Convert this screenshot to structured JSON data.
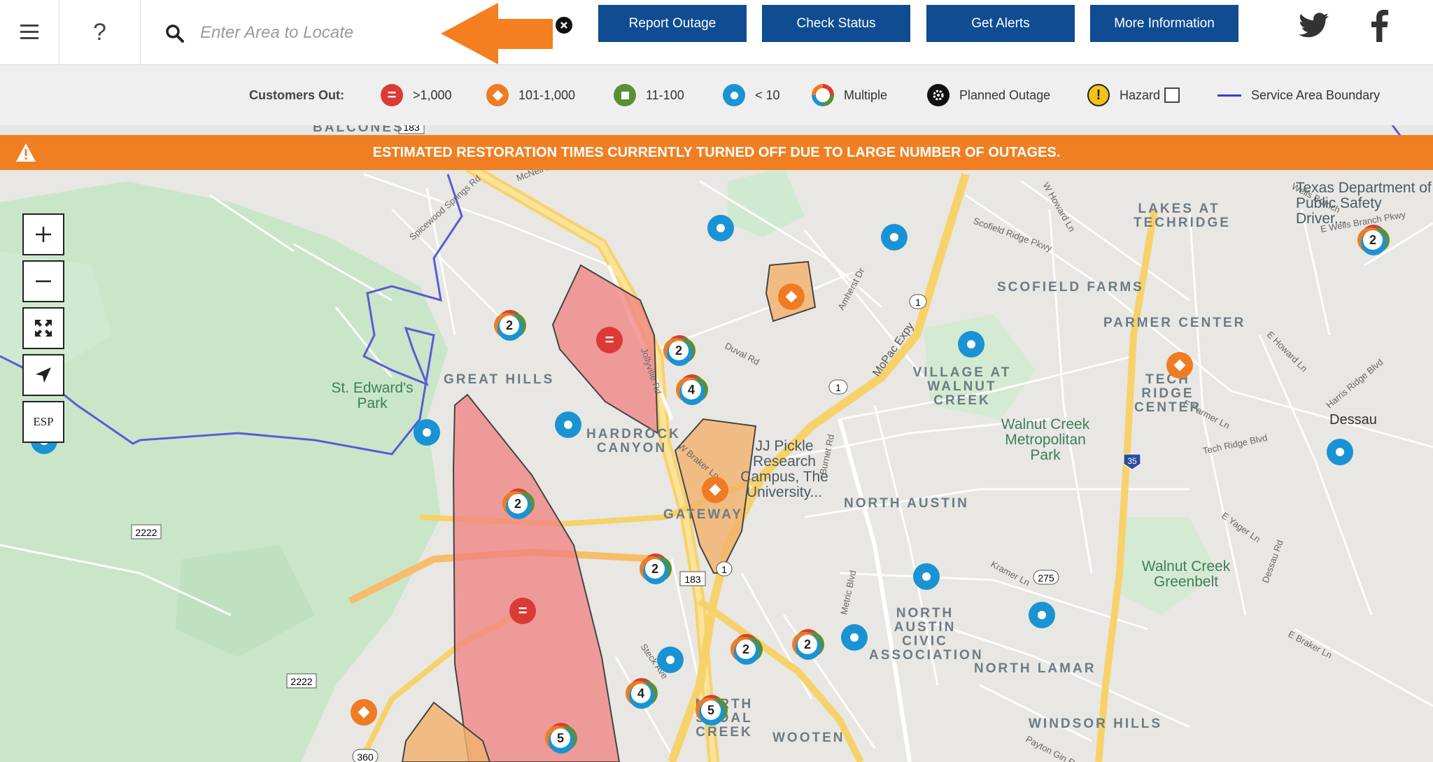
{
  "header": {
    "help_label": "?",
    "search_placeholder": "Enter Area to Locate",
    "buttons": [
      "Report Outage",
      "Check Status",
      "Get Alerts",
      "More Information"
    ]
  },
  "legend": {
    "title": "Customers Out:",
    "items": [
      ">1,000",
      "101-1,000",
      "11-100",
      "< 10",
      "Multiple",
      "Planned Outage",
      "Hazard",
      "Service Area Boundary"
    ]
  },
  "banner": {
    "text": "ESTIMATED RESTORATION TIMES CURRENTLY TURNED OFF DUE TO LARGE NUMBER OF OUTAGES."
  },
  "controls": {
    "language_label": "ESP"
  },
  "map_labels": {
    "areas": [
      "GREAT HILLS",
      "HARDROCK CANYON",
      "GATEWAY",
      "NORTH AUSTIN",
      "LAKES AT TECHRIDGE",
      "SCOFIELD FARMS",
      "PARMER CENTER",
      "VILLAGE AT WALNUT CREEK",
      "TECH RIDGE CENTER",
      "NORTH AUSTIN CIVIC ASSOCIATION",
      "NORTH LAMAR",
      "NORTH SHOAL CREEK",
      "WOOTEN",
      "WINDSOR HILLS",
      "BALCONES"
    ],
    "parks": [
      "St. Edward's Park",
      "Walnut Creek Metropolitan Park",
      "Walnut Creek Greenbelt"
    ],
    "places": [
      "JJ Pickle Research Campus, The University...",
      "Texas Department of Public Safety Driver...",
      "Dessau"
    ],
    "roads": [
      "MoPac Expy",
      "Duval Rd",
      "Spicewood Springs Rd",
      "Jollyville Rd",
      "W Braker Ln",
      "Burnet Rd",
      "Metric Blvd",
      "Scofield Ridge Pkwy",
      "Wells Branch",
      "Tech Ridge Blvd",
      "E Yager Ln",
      "Kramer Ln",
      "Dessau Rd",
      "E Braker Ln",
      "Payton Gin Rd",
      "Steck Ave",
      "McNeil Dr",
      "Amherst Dr",
      "W Howard Ln",
      "E Howard Ln",
      "Harris Ridge Blvd",
      "E Parmer Ln",
      "E Wells Branch Pkwy"
    ],
    "shields": [
      "183",
      "1",
      "1",
      "35",
      "275",
      "2222",
      "2222",
      "360",
      "183",
      "1"
    ]
  },
  "map_counts": [
    "2",
    "2",
    "4",
    "2",
    "2",
    "2",
    "2",
    "4",
    "5",
    "5",
    "2"
  ],
  "colors": {
    "nav_button": "#0f4c92",
    "banner": "#f07f23",
    "outage_large": "#dc3a36",
    "outage_medium": "#ef7c22",
    "outage_small": "#5a8f3a",
    "outage_tiny": "#1993d3",
    "boundary": "#5b5bd6"
  }
}
